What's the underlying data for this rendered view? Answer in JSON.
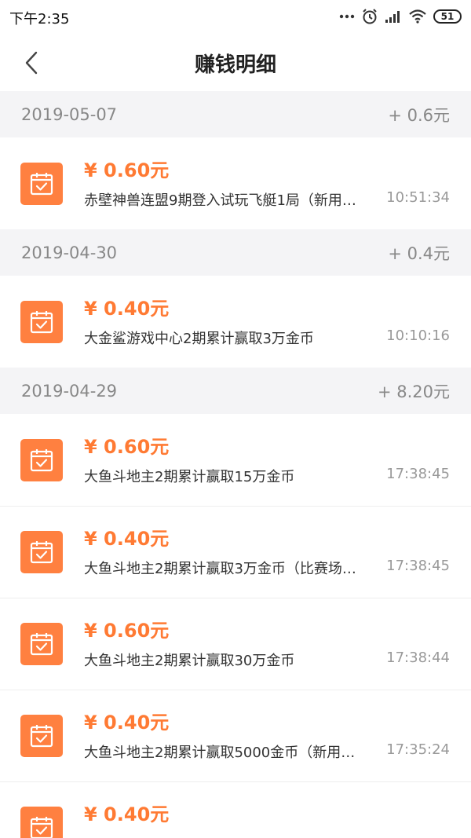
{
  "status_bar": {
    "time": "下午2:35",
    "battery": "51",
    "icons": [
      "dots-icon",
      "alarm-icon",
      "signal-icon",
      "wifi-icon",
      "battery-icon"
    ]
  },
  "nav": {
    "back_icon": "chevron-left-icon",
    "title": "赚钱明细"
  },
  "colors": {
    "accent": "#ff7a33",
    "icon_bg": "#ff8040",
    "group_bg": "#f4f4f6"
  },
  "groups": [
    {
      "date": "2019-05-07",
      "total": "+ 0.6元",
      "items": [
        {
          "amount": "¥ 0.60元",
          "desc": "赤壁神兽连盟9期登入试玩飞艇1局（新用…",
          "time": "10:51:34"
        }
      ]
    },
    {
      "date": "2019-04-30",
      "total": "+ 0.4元",
      "items": [
        {
          "amount": "¥ 0.40元",
          "desc": "大金鲨游戏中心2期累计赢取3万金币",
          "time": "10:10:16"
        }
      ]
    },
    {
      "date": "2019-04-29",
      "total": "+ 8.20元",
      "items": [
        {
          "amount": "¥ 0.60元",
          "desc": "大鱼斗地主2期累计赢取15万金币",
          "time": "17:38:45"
        },
        {
          "amount": "¥ 0.40元",
          "desc": "大鱼斗地主2期累计赢取3万金币（比赛场…",
          "time": "17:38:45"
        },
        {
          "amount": "¥ 0.60元",
          "desc": "大鱼斗地主2期累计赢取30万金币",
          "time": "17:38:44"
        },
        {
          "amount": "¥ 0.40元",
          "desc": "大鱼斗地主2期累计赢取5000金币（新用…",
          "time": "17:35:24"
        },
        {
          "amount": "¥ 0.40元",
          "desc": "",
          "time": ""
        }
      ]
    }
  ]
}
